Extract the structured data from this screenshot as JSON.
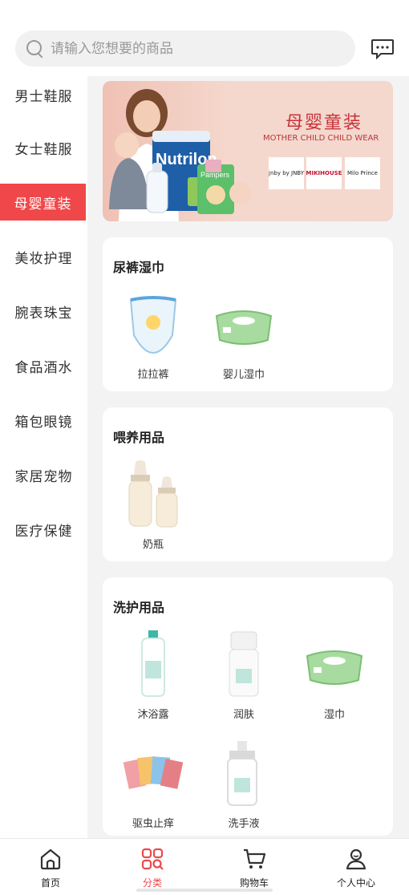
{
  "search": {
    "placeholder": "请输入您想要的商品"
  },
  "sidebar": {
    "items": [
      {
        "label": "男士鞋服"
      },
      {
        "label": "女士鞋服"
      },
      {
        "label": "母婴童装",
        "active": true
      },
      {
        "label": "美妆护理"
      },
      {
        "label": "腕表珠宝"
      },
      {
        "label": "食品酒水"
      },
      {
        "label": "箱包眼镜"
      },
      {
        "label": "家居宠物"
      },
      {
        "label": "医疗保健"
      }
    ]
  },
  "banner": {
    "title": "母婴童装",
    "subtitle": "MOTHER CHILD CHILD WEAR",
    "product_text": "Nutrilon",
    "product_text2": "Pampers",
    "brands": [
      "jnby by JNBY",
      "MIKIHOUSE",
      "Milo Prince"
    ]
  },
  "sections": [
    {
      "title": "尿裤湿巾",
      "products": [
        {
          "label": "拉拉裤"
        },
        {
          "label": "婴儿湿巾"
        }
      ]
    },
    {
      "title": "喂养用品",
      "products": [
        {
          "label": "奶瓶"
        }
      ]
    },
    {
      "title": "洗护用品",
      "products": [
        {
          "label": "沐浴露"
        },
        {
          "label": "润肤"
        },
        {
          "label": "湿巾"
        },
        {
          "label": "驱虫止痒"
        },
        {
          "label": "洗手液"
        }
      ]
    }
  ],
  "tabbar": {
    "items": [
      {
        "label": "首页",
        "icon": "home-icon"
      },
      {
        "label": "分类",
        "icon": "category-icon",
        "active": true
      },
      {
        "label": "购物车",
        "icon": "cart-icon"
      },
      {
        "label": "个人中心",
        "icon": "user-icon"
      }
    ]
  },
  "colors": {
    "accent": "#f0474a",
    "content_bg": "#f3f3f3"
  }
}
